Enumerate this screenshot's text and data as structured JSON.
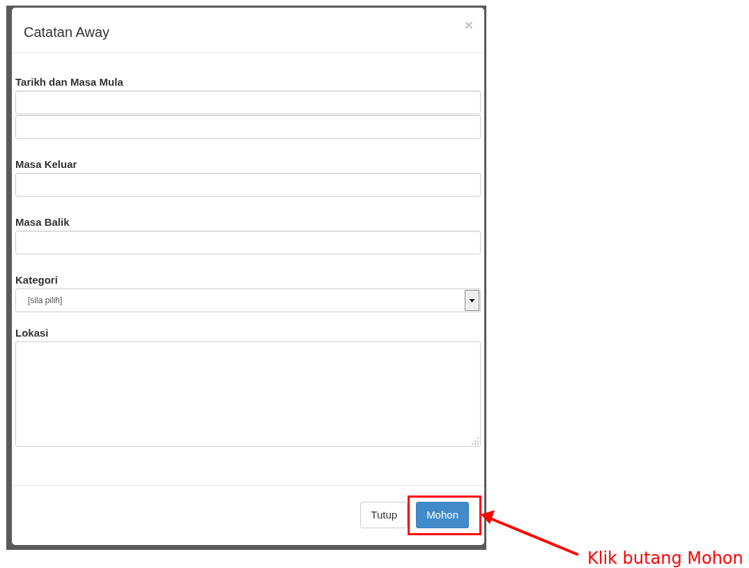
{
  "dialog": {
    "title": "Catatan Away",
    "close": "×",
    "fields": [
      {
        "label": "Tarikh dan Masa Mula",
        "inputs": [
          {
            "kind": "text"
          },
          {
            "kind": "text"
          }
        ]
      },
      {
        "label": "Masa Keluar",
        "inputs": [
          {
            "kind": "text"
          }
        ]
      },
      {
        "label": "Masa Balik",
        "inputs": [
          {
            "kind": "text"
          }
        ]
      },
      {
        "label": "Kategori",
        "inputs": [
          {
            "kind": "select",
            "value": "[sila pilih]"
          }
        ]
      },
      {
        "label": "Lokasi",
        "inputs": [
          {
            "kind": "textarea"
          }
        ]
      }
    ],
    "buttons": [
      {
        "label": "Tutup",
        "kind": "default"
      },
      {
        "label": "Mohon",
        "kind": "primary"
      }
    ]
  },
  "annotation": {
    "text": "Klik butang Mohon"
  }
}
